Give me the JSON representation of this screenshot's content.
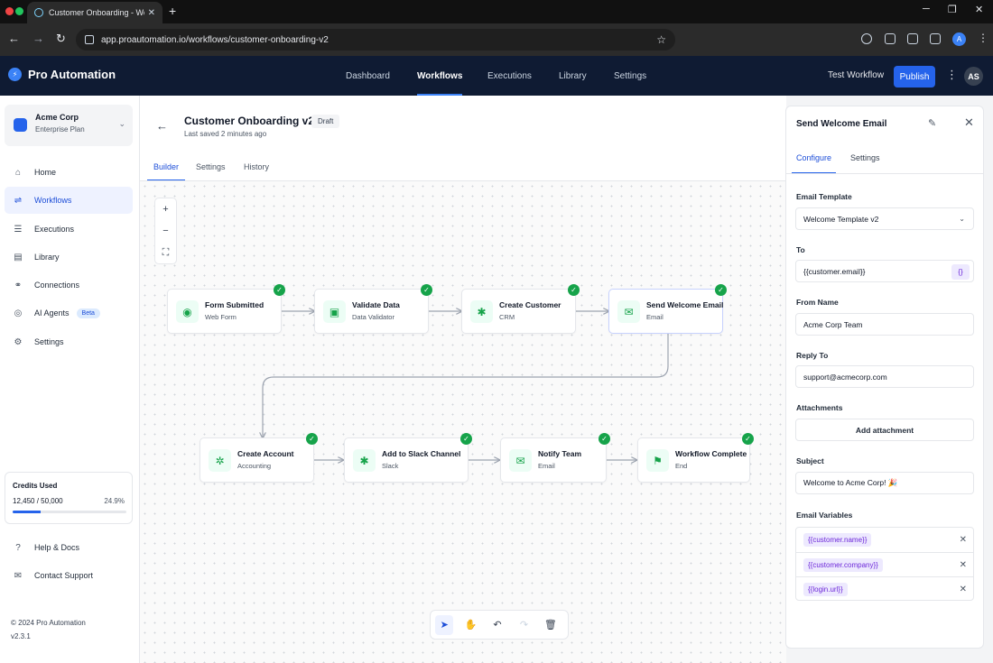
{
  "browser": {
    "tab_title": "Customer Onboarding - Workfl",
    "url": "app.proautomation.io/workflows/customer-onboarding-v2",
    "profile_initial": "A"
  },
  "header": {
    "brand": "Pro Automation",
    "nav": [
      {
        "label": "Dashboard",
        "active": false
      },
      {
        "label": "Workflows",
        "active": true
      },
      {
        "label": "Executions",
        "active": false
      },
      {
        "label": "Library",
        "active": false
      },
      {
        "label": "Settings",
        "active": false
      }
    ],
    "test_workflow": "Test Workflow",
    "publish": "Publish",
    "avatar_initials": "AS"
  },
  "sidebar": {
    "org_name": "Acme Corp",
    "org_plan": "Enterprise Plan",
    "items": [
      {
        "label": "Home",
        "icon": "home-icon"
      },
      {
        "label": "Workflows",
        "icon": "workflows-icon",
        "active": true
      },
      {
        "label": "Executions",
        "icon": "list-icon"
      },
      {
        "label": "Library",
        "icon": "book-icon"
      },
      {
        "label": "Connections",
        "icon": "link-icon"
      },
      {
        "label": "AI Agents",
        "icon": "robot-icon",
        "badge": "Beta"
      },
      {
        "label": "Settings",
        "icon": "gear-icon"
      }
    ],
    "credits": {
      "title": "Credits Used",
      "value": "12,450 / 50,000",
      "percent_label": "24.9%",
      "fraction": 0.249
    },
    "help": "Help & Docs",
    "support": "Contact Support",
    "copyright": "© 2024 Pro Automation",
    "version": "v2.3.1"
  },
  "workflow": {
    "title": "Customer Onboarding v2",
    "status": "Draft",
    "saved": "Last saved 2 minutes ago",
    "tabs": [
      "Builder",
      "Settings",
      "History"
    ],
    "nodes": [
      {
        "title": "Form Submitted",
        "subtitle": "Web Form",
        "icon": "form-icon"
      },
      {
        "title": "Validate Data",
        "subtitle": "Data Validator",
        "icon": "document-icon"
      },
      {
        "title": "Create Customer",
        "subtitle": "CRM",
        "icon": "crm-icon"
      },
      {
        "title": "Send Welcome Email",
        "subtitle": "Email",
        "icon": "mail-icon"
      },
      {
        "title": "Create Account",
        "subtitle": "Accounting",
        "icon": "accounting-icon"
      },
      {
        "title": "Add to Slack Channel",
        "subtitle": "Slack",
        "icon": "slack-icon"
      },
      {
        "title": "Notify Team",
        "subtitle": "Email",
        "icon": "mail-icon"
      },
      {
        "title": "Workflow Complete",
        "subtitle": "End",
        "icon": "flag-icon"
      }
    ]
  },
  "panel": {
    "title": "Send Welcome Email",
    "tabs": [
      "Configure",
      "Settings"
    ],
    "email_template_label": "Email Template",
    "email_template_value": "Welcome Template v2",
    "to_label": "To",
    "to_value": "{{customer.email}}",
    "var_button": "{}",
    "from_label": "From Name",
    "from_value": "Acme Corp Team",
    "reply_label": "Reply To",
    "reply_value": "support@acmecorp.com",
    "attachments_label": "Attachments",
    "add_attachment": "Add attachment",
    "subject_label": "Subject",
    "subject_value": "Welcome to Acme Corp! 🎉",
    "variables_label": "Email Variables",
    "variables": [
      "{{customer.name}}",
      "{{customer.company}}",
      "{{login.url}}"
    ]
  },
  "colors": {
    "accent": "#2563eb",
    "header_bg": "#0f1b33",
    "success": "#16a34a",
    "variable": "#6d28d9"
  }
}
